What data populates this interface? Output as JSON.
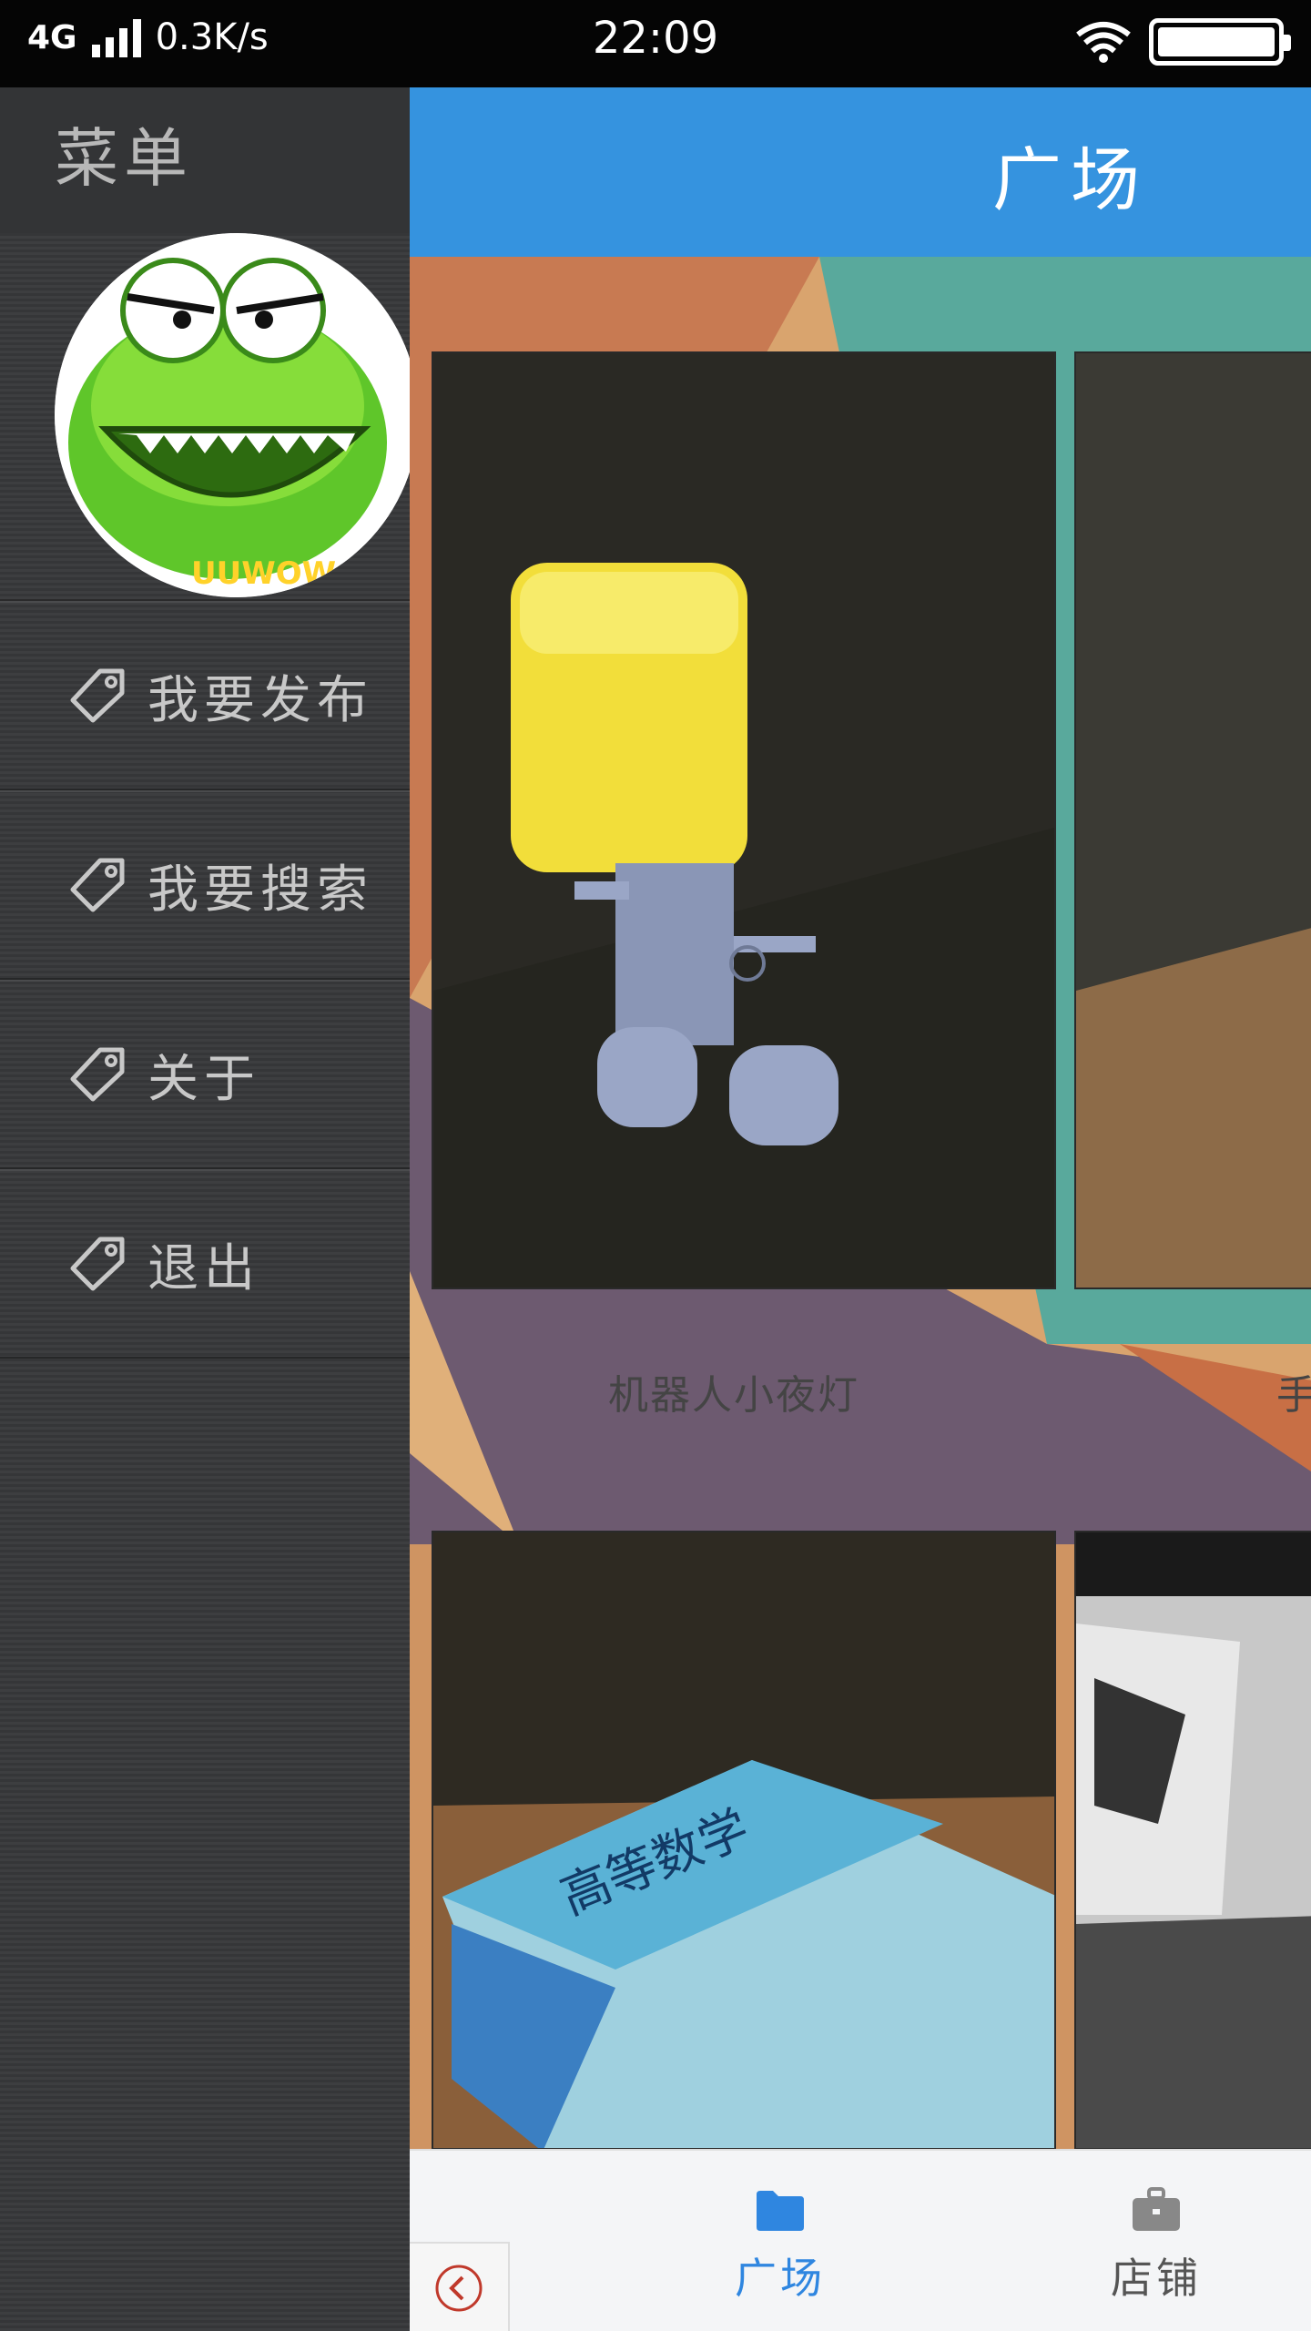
{
  "status_bar": {
    "network": "4G",
    "speed": "0.3K/s",
    "time": "22:09"
  },
  "drawer": {
    "title": "菜单",
    "menu_items": [
      {
        "label": "我要发布",
        "icon": "tag-icon"
      },
      {
        "label": "我要搜索",
        "icon": "tag-icon"
      },
      {
        "label": "关于",
        "icon": "tag-icon"
      },
      {
        "label": "退出",
        "icon": "tag-icon"
      }
    ]
  },
  "app_bar": {
    "title": "广场"
  },
  "products": [
    {
      "name": "机器人小夜灯"
    },
    {
      "name": "手"
    }
  ],
  "bottom_nav": {
    "items": [
      {
        "label": "广场",
        "icon": "folder-icon",
        "active": true
      },
      {
        "label": "店铺",
        "icon": "briefcase-icon",
        "active": false
      }
    ],
    "active_color": "#2f86e0",
    "inactive_color": "#555555"
  },
  "colors": {
    "app_bar": "#3593df",
    "drawer": "#38393b"
  }
}
